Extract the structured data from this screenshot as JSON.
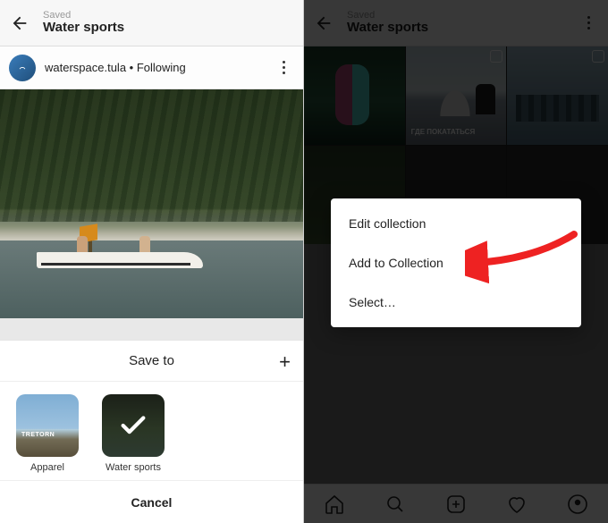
{
  "left": {
    "header": {
      "small": "Saved",
      "title": "Water sports"
    },
    "author": {
      "text": "waterspace.tula • Following"
    },
    "sheet": {
      "title": "Save to",
      "collections": [
        {
          "label": "Apparel",
          "selected": false
        },
        {
          "label": "Water sports",
          "selected": true
        }
      ],
      "cancel": "Cancel"
    }
  },
  "right": {
    "header": {
      "small": "Saved",
      "title": "Water sports"
    },
    "grid_caption_2": "ГДЕ ПОКАТАТЬСЯ",
    "popup": {
      "edit": "Edit collection",
      "add": "Add to Collection",
      "select": "Select…"
    }
  }
}
